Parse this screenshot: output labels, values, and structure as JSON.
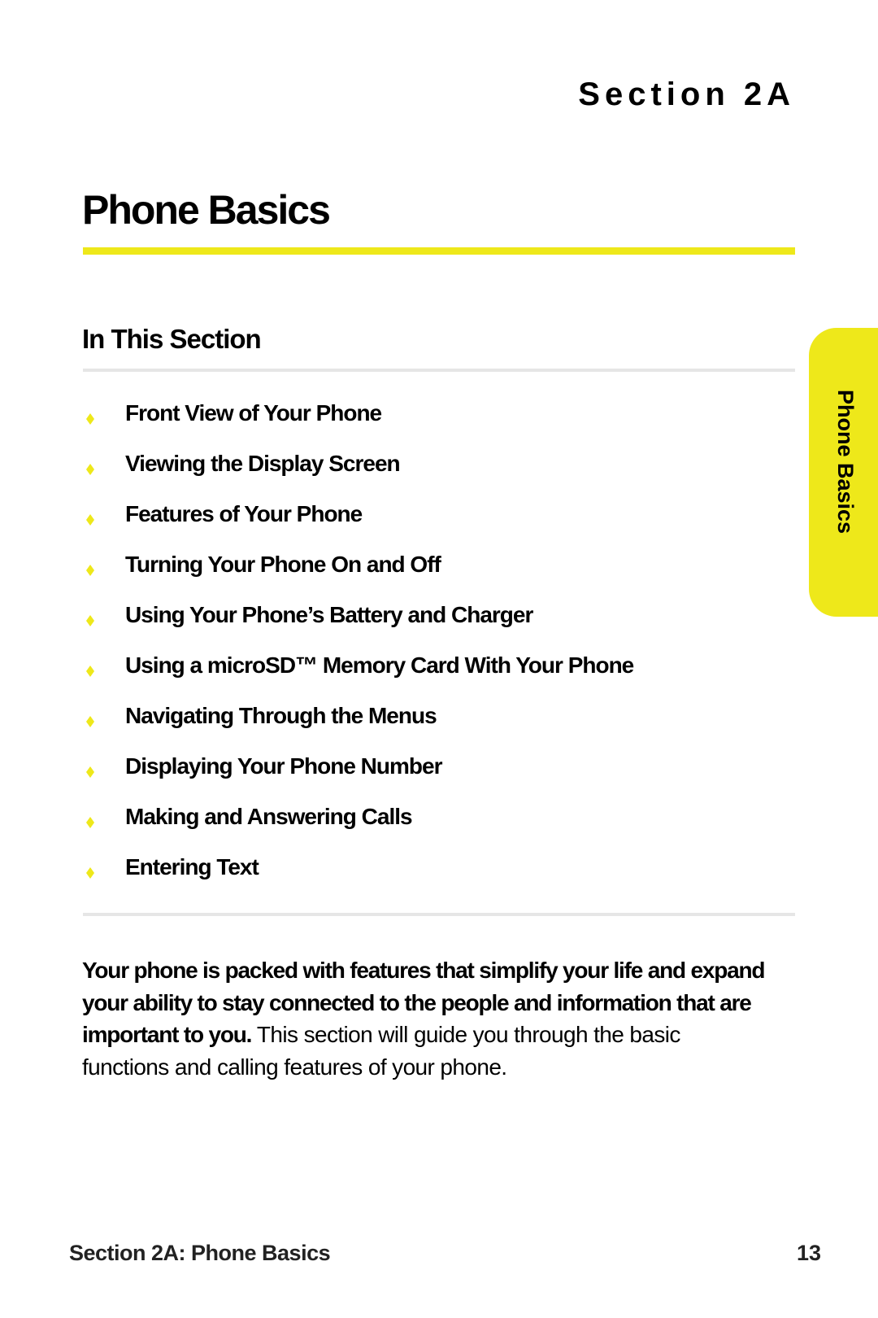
{
  "header": {
    "section_label": "Section 2A",
    "page_title": "Phone Basics"
  },
  "side_tab": {
    "label": "Phone Basics",
    "color": "#eee81a"
  },
  "in_this_section": {
    "title": "In This Section",
    "bullet_icon": "yellow-diamond-icon",
    "items": [
      {
        "label": "Front View of Your Phone"
      },
      {
        "label": "Viewing the Display Screen"
      },
      {
        "label": "Features of Your Phone"
      },
      {
        "label": "Turning Your Phone On and Off"
      },
      {
        "label": "Using Your Phone’s Battery and Charger"
      },
      {
        "label": "Using a microSD™ Memory Card With Your Phone"
      },
      {
        "label": "Navigating Through the Menus"
      },
      {
        "label": "Displaying Your Phone Number"
      },
      {
        "label": "Making and Answering Calls"
      },
      {
        "label": "Entering Text"
      }
    ]
  },
  "intro": {
    "lead_bold": "Your phone is packed with features that simplify your life and expand your ability to stay connected to the people and information that are important to you.",
    "body": " This section will guide you through the basic functions and calling features of your phone."
  },
  "footer": {
    "section_ref": "Section 2A: Phone Basics",
    "page_number": "13"
  },
  "colors": {
    "accent_yellow": "#eee81a",
    "rule_gray": "#e6e6e6",
    "text": "#000000"
  }
}
